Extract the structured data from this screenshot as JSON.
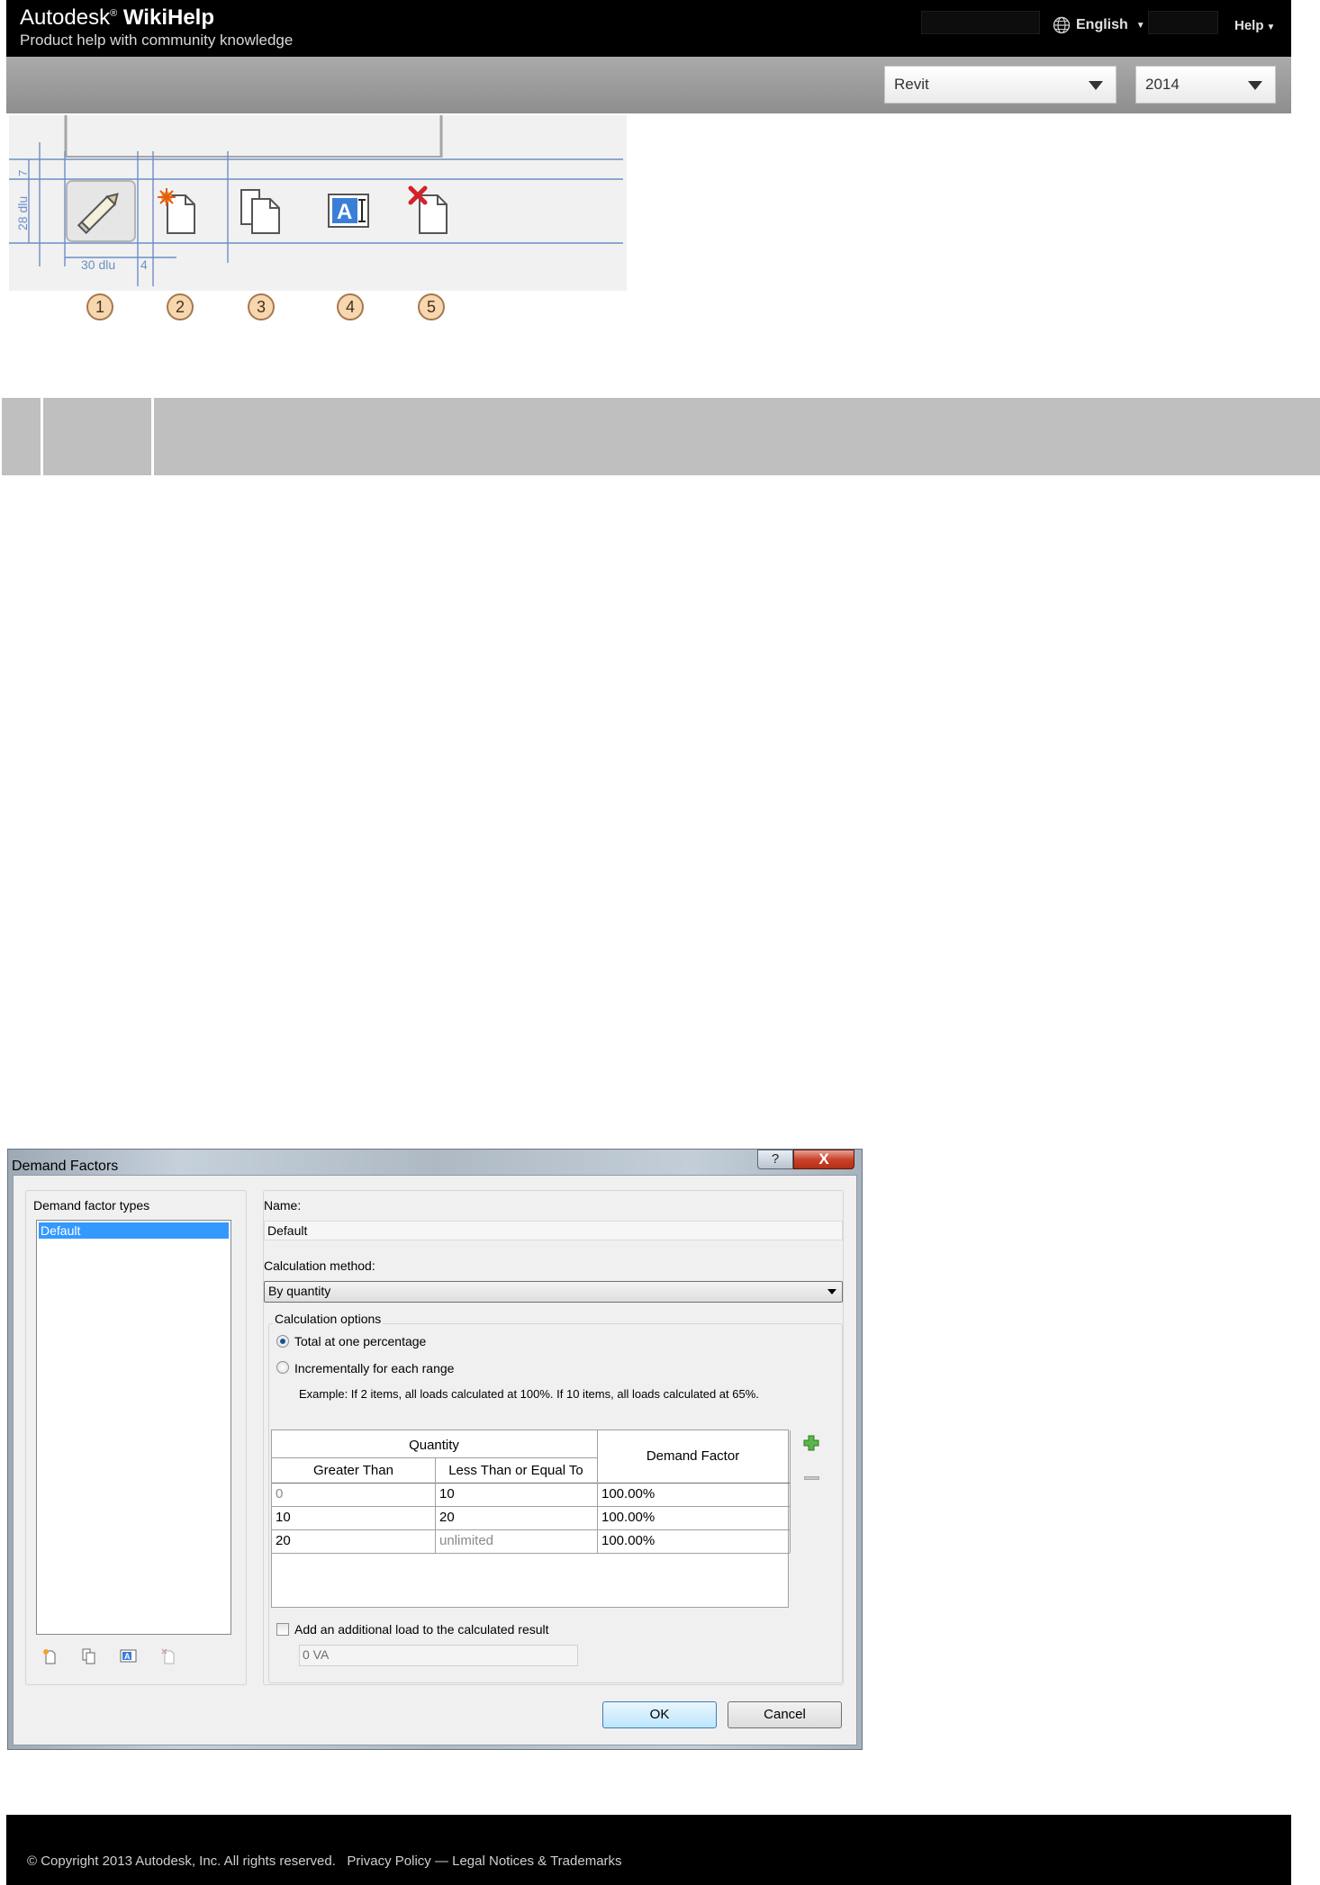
{
  "header": {
    "brand_prefix": "Autodesk",
    "brand_reg": "®",
    "brand_name": "WikiHelp",
    "tagline": "Product help with community knowledge",
    "language": "English",
    "help": "Help"
  },
  "product_bar": {
    "product": "Revit",
    "version": "2014"
  },
  "diagram": {
    "dim_height": "28 dlu",
    "dim_top": "7",
    "dim_width": "30 dlu",
    "dim_gap": "4",
    "callouts": [
      "1",
      "2",
      "3",
      "4",
      "5"
    ],
    "icons": [
      "pencil-edit-icon",
      "new-document-icon",
      "duplicate-document-icon",
      "rename-text-icon",
      "delete-document-icon"
    ]
  },
  "dialog": {
    "title": "Demand Factors",
    "help_button": "?",
    "close_button": "X",
    "types_label": "Demand factor types",
    "types": [
      "Default"
    ],
    "name_label": "Name:",
    "name_value": "Default",
    "method_label": "Calculation method:",
    "method_value": "By quantity",
    "options_label": "Calculation options",
    "option_total": "Total at one percentage",
    "option_incremental": "Incrementally for each range",
    "example": "Example: If 2 items, all loads calculated at 100%. If 10 items, all loads calculated at 65%.",
    "grid": {
      "group_header": "Quantity",
      "col_greater": "Greater Than",
      "col_less": "Less Than or Equal To",
      "col_factor": "Demand Factor",
      "rows": [
        {
          "greater": "0",
          "less": "10",
          "factor": "100.00%"
        },
        {
          "greater": "10",
          "less": "20",
          "factor": "100.00%"
        },
        {
          "greater": "20",
          "less": "unlimited",
          "factor": "100.00%"
        }
      ]
    },
    "add_load_label": "Add an additional load to the calculated result",
    "add_load_value": "0 VA",
    "ok": "OK",
    "cancel": "Cancel"
  },
  "footer": {
    "copyright": "© Copyright 2013 Autodesk, Inc. All rights reserved.",
    "privacy": "Privacy Policy",
    "separator": "—",
    "legal": "Legal Notices & Trademarks"
  }
}
